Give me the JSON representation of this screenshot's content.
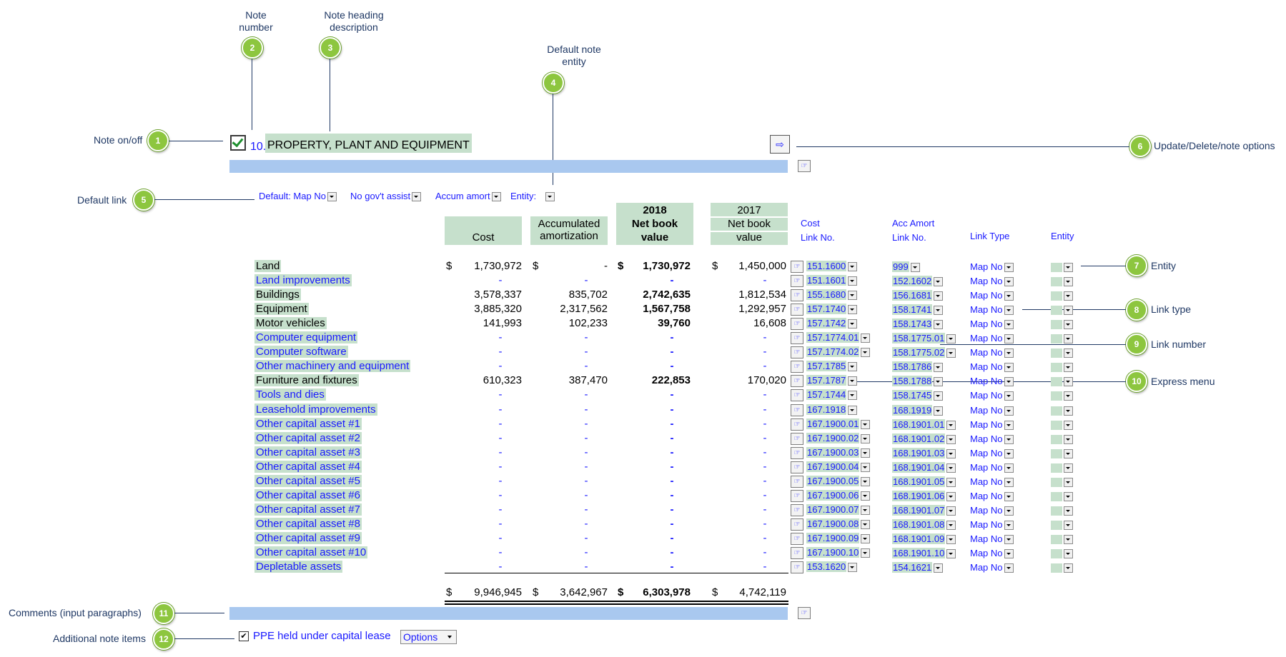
{
  "annotations": {
    "note_number": "Note\nnumber",
    "note_heading": "Note heading\ndescription",
    "default_entity": "Default note\nentity",
    "note_onoff": "Note on/off",
    "default_link": "Default link",
    "update_options": "Update/Delete/note options",
    "entity": "Entity",
    "link_type": "Link type",
    "link_number": "Link number",
    "express_menu": "Express menu",
    "comments": "Comments (input paragraphs)",
    "additional": "Additional note items"
  },
  "bubbles": [
    "1",
    "2",
    "3",
    "4",
    "5",
    "6",
    "7",
    "8",
    "9",
    "10",
    "11",
    "12"
  ],
  "note": {
    "number": "10.",
    "title": "PROPERTY, PLANT AND EQUIPMENT"
  },
  "defaults": {
    "map": "Default: Map No",
    "gov": "No gov't assist",
    "amort": "Accum amort",
    "entity": "Entity:"
  },
  "columns": {
    "cost": "Cost",
    "accum1": "Accumulated",
    "accum2": "amortization",
    "y2018": "2018",
    "nbv1": "Net book",
    "nbv2": "value",
    "y2017": "2017",
    "nbv17_1": "Net book",
    "nbv17_2": "value",
    "cost_link1": "Cost",
    "cost_link2": "Link No.",
    "acc_link1": "Acc Amort",
    "acc_link2": "Link No.",
    "link_type": "Link Type",
    "entity": "Entity"
  },
  "currency": "$",
  "rows": [
    {
      "name": "Land",
      "cost": "1,730,972",
      "accum": "-",
      "nbv": "1,730,972",
      "py": "1,450,000",
      "cl": "151.1600",
      "al": "999",
      "lt": "Map No",
      "active": true
    },
    {
      "name": "Land improvements",
      "cost": "-",
      "accum": "-",
      "nbv": "-",
      "py": "-",
      "cl": "151.1601",
      "al": "152.1602",
      "lt": "Map No",
      "active": false
    },
    {
      "name": "Buildings",
      "cost": "3,578,337",
      "accum": "835,702",
      "nbv": "2,742,635",
      "py": "1,812,534",
      "cl": "155.1680",
      "al": "156.1681",
      "lt": "Map No",
      "active": true
    },
    {
      "name": "Equipment",
      "cost": "3,885,320",
      "accum": "2,317,562",
      "nbv": "1,567,758",
      "py": "1,292,957",
      "cl": "157.1740",
      "al": "158.1741",
      "lt": "Map No",
      "active": true
    },
    {
      "name": "Motor vehicles",
      "cost": "141,993",
      "accum": "102,233",
      "nbv": "39,760",
      "py": "16,608",
      "cl": "157.1742",
      "al": "158.1743",
      "lt": "Map No",
      "active": true
    },
    {
      "name": "Computer equipment",
      "cost": "-",
      "accum": "-",
      "nbv": "-",
      "py": "-",
      "cl": "157.1774.01",
      "al": "158.1775.01",
      "lt": "Map No",
      "active": false
    },
    {
      "name": "Computer software",
      "cost": "-",
      "accum": "-",
      "nbv": "-",
      "py": "-",
      "cl": "157.1774.02",
      "al": "158.1775.02",
      "lt": "Map No",
      "active": false
    },
    {
      "name": "Other machinery and equipment",
      "cost": "-",
      "accum": "-",
      "nbv": "-",
      "py": "-",
      "cl": "157.1785",
      "al": "158.1786",
      "lt": "Map No",
      "active": false
    },
    {
      "name": "Furniture and fixtures",
      "cost": "610,323",
      "accum": "387,470",
      "nbv": "222,853",
      "py": "170,020",
      "cl": "157.1787",
      "al": "158.1788",
      "lt": "Map No",
      "active": true
    },
    {
      "name": "Tools and dies",
      "cost": "-",
      "accum": "-",
      "nbv": "-",
      "py": "-",
      "cl": "157.1744",
      "al": "158.1745",
      "lt": "Map No",
      "active": false
    },
    {
      "name": "Leasehold improvements",
      "cost": "-",
      "accum": "-",
      "nbv": "-",
      "py": "-",
      "cl": "167.1918",
      "al": "168.1919",
      "lt": "Map No",
      "active": false
    },
    {
      "name": "Other capital asset #1",
      "cost": "-",
      "accum": "-",
      "nbv": "-",
      "py": "-",
      "cl": "167.1900.01",
      "al": "168.1901.01",
      "lt": "Map No",
      "active": false
    },
    {
      "name": "Other capital asset #2",
      "cost": "-",
      "accum": "-",
      "nbv": "-",
      "py": "-",
      "cl": "167.1900.02",
      "al": "168.1901.02",
      "lt": "Map No",
      "active": false
    },
    {
      "name": "Other capital asset #3",
      "cost": "-",
      "accum": "-",
      "nbv": "-",
      "py": "-",
      "cl": "167.1900.03",
      "al": "168.1901.03",
      "lt": "Map No",
      "active": false
    },
    {
      "name": "Other capital asset #4",
      "cost": "-",
      "accum": "-",
      "nbv": "-",
      "py": "-",
      "cl": "167.1900.04",
      "al": "168.1901.04",
      "lt": "Map No",
      "active": false
    },
    {
      "name": "Other capital asset #5",
      "cost": "-",
      "accum": "-",
      "nbv": "-",
      "py": "-",
      "cl": "167.1900.05",
      "al": "168.1901.05",
      "lt": "Map No",
      "active": false
    },
    {
      "name": "Other capital asset #6",
      "cost": "-",
      "accum": "-",
      "nbv": "-",
      "py": "-",
      "cl": "167.1900.06",
      "al": "168.1901.06",
      "lt": "Map No",
      "active": false
    },
    {
      "name": "Other capital asset #7",
      "cost": "-",
      "accum": "-",
      "nbv": "-",
      "py": "-",
      "cl": "167.1900.07",
      "al": "168.1901.07",
      "lt": "Map No",
      "active": false
    },
    {
      "name": "Other capital asset #8",
      "cost": "-",
      "accum": "-",
      "nbv": "-",
      "py": "-",
      "cl": "167.1900.08",
      "al": "168.1901.08",
      "lt": "Map No",
      "active": false
    },
    {
      "name": "Other capital asset #9",
      "cost": "-",
      "accum": "-",
      "nbv": "-",
      "py": "-",
      "cl": "167.1900.09",
      "al": "168.1901.09",
      "lt": "Map No",
      "active": false
    },
    {
      "name": "Other capital asset #10",
      "cost": "-",
      "accum": "-",
      "nbv": "-",
      "py": "-",
      "cl": "167.1900.10",
      "al": "168.1901.10",
      "lt": "Map No",
      "active": false
    },
    {
      "name": "Depletable assets",
      "cost": "-",
      "accum": "-",
      "nbv": "-",
      "py": "-",
      "cl": "153.1620",
      "al": "154.1621",
      "lt": "Map No",
      "active": false
    }
  ],
  "totals": {
    "cost": "9,946,945",
    "accum": "3,642,967",
    "nbv": "6,303,978",
    "py": "4,742,119"
  },
  "additional_item": {
    "label": "PPE held under capital lease",
    "options": "Options"
  },
  "icons": {
    "hand": "hand-pointer-icon",
    "update": "note-options-icon"
  },
  "colors": {
    "highlight": "#c6e0cc",
    "bar": "#a9c8ef",
    "link": "#1a1aff",
    "callout": "#8dc63f"
  }
}
